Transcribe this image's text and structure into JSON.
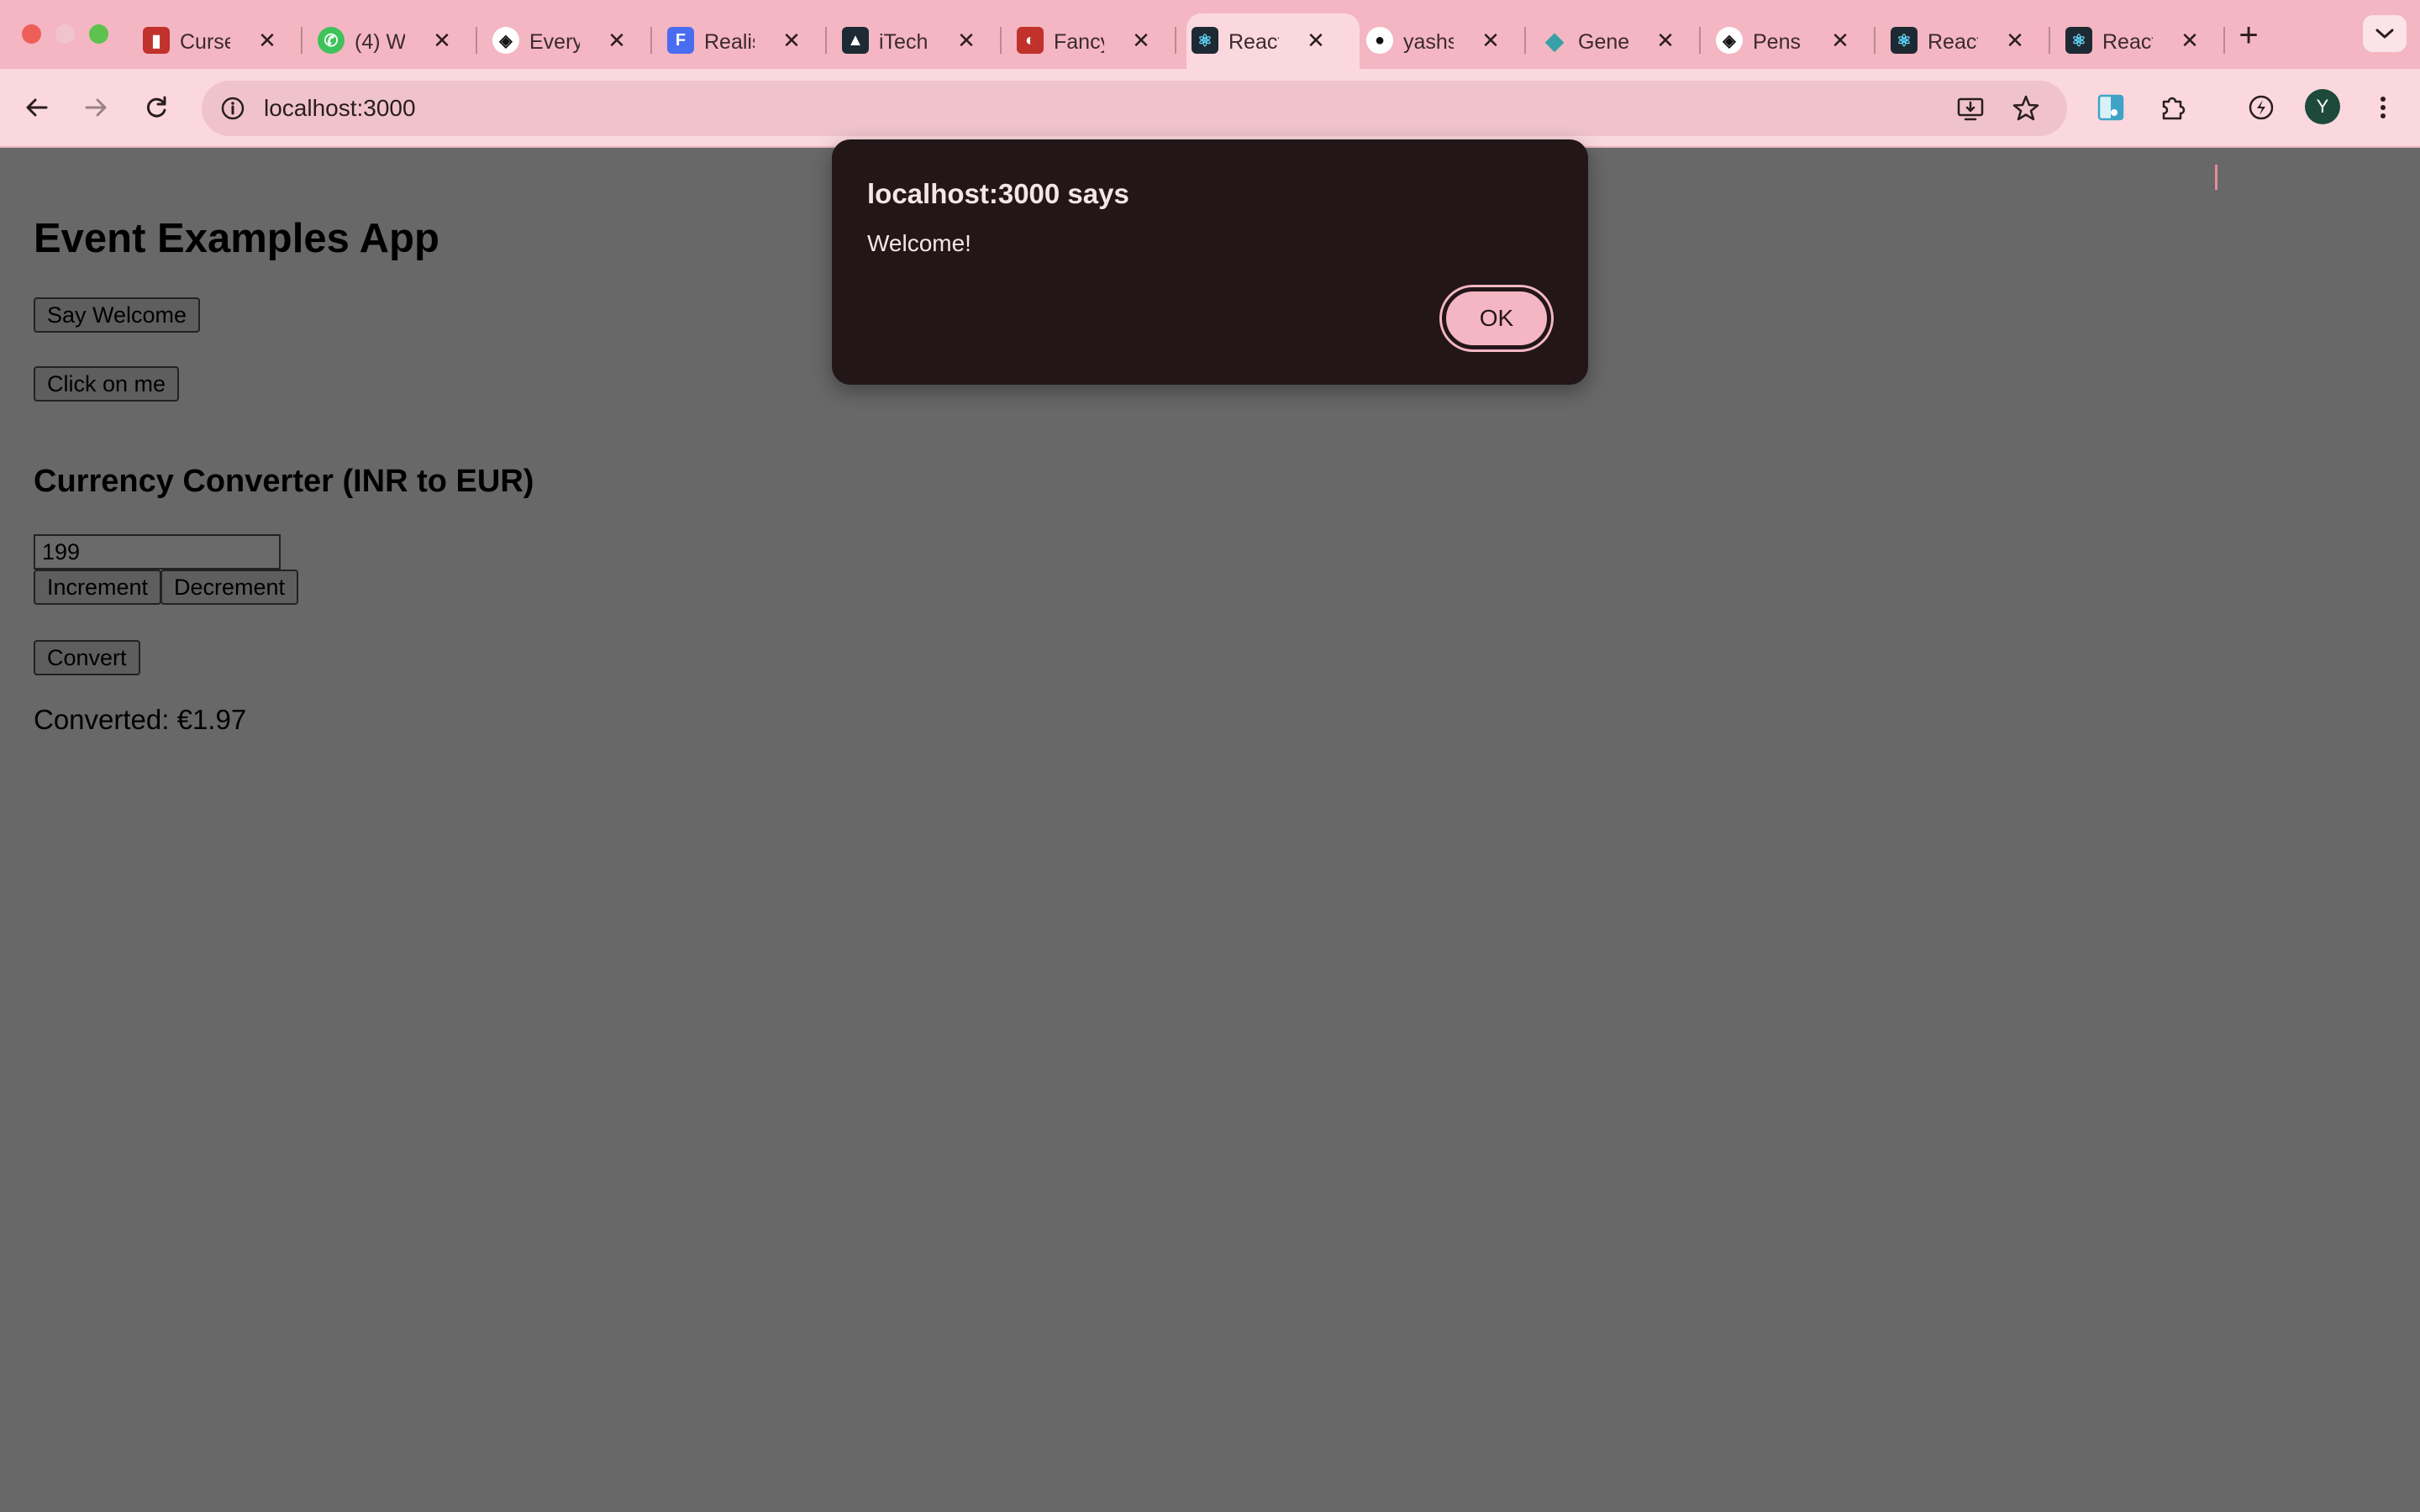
{
  "browser": {
    "tabs": [
      {
        "title": "Curse",
        "icon": "brand-mark-red-icon",
        "color": "#c0322b"
      },
      {
        "title": "(4) W",
        "icon": "whatsapp-icon",
        "color": "#3ec35a"
      },
      {
        "title": "Every",
        "icon": "codepen-icon",
        "color": "#111111"
      },
      {
        "title": "Realis",
        "icon": "document-app-icon",
        "color": "#4a6cf0"
      },
      {
        "title": "iTechI",
        "icon": "dark-site-icon",
        "color": "#111111"
      },
      {
        "title": "Fancy",
        "icon": "fancy-logo-icon",
        "color": "#c0322b"
      },
      {
        "title": "React",
        "icon": "react-icon",
        "color": "#61dafb"
      },
      {
        "title": "yashs",
        "icon": "github-icon",
        "color": "#111111"
      },
      {
        "title": "Gener",
        "icon": "diamond-icon",
        "color": "#3aa0a8"
      },
      {
        "title": "Pens",
        "icon": "codepen-icon",
        "color": "#111111"
      },
      {
        "title": "React",
        "icon": "react-icon",
        "color": "#61dafb"
      },
      {
        "title": "React",
        "icon": "react-icon",
        "color": "#61dafb"
      }
    ],
    "active_tab_index": 6,
    "url": "localhost:3000",
    "profile_initial": "Y",
    "accent_color": "#f4b6c2"
  },
  "page": {
    "title": "Event Examples App",
    "say_welcome_label": "Say Welcome",
    "click_me_label": "Click on me",
    "converter_title": "Currency Converter (INR to EUR)",
    "amount_value": "199",
    "increment_label": "Increment",
    "decrement_label": "Decrement",
    "convert_label": "Convert",
    "converted_text": "Converted: €1.97"
  },
  "dialog": {
    "title": "localhost:3000 says",
    "message": "Welcome!",
    "ok_label": "OK"
  }
}
